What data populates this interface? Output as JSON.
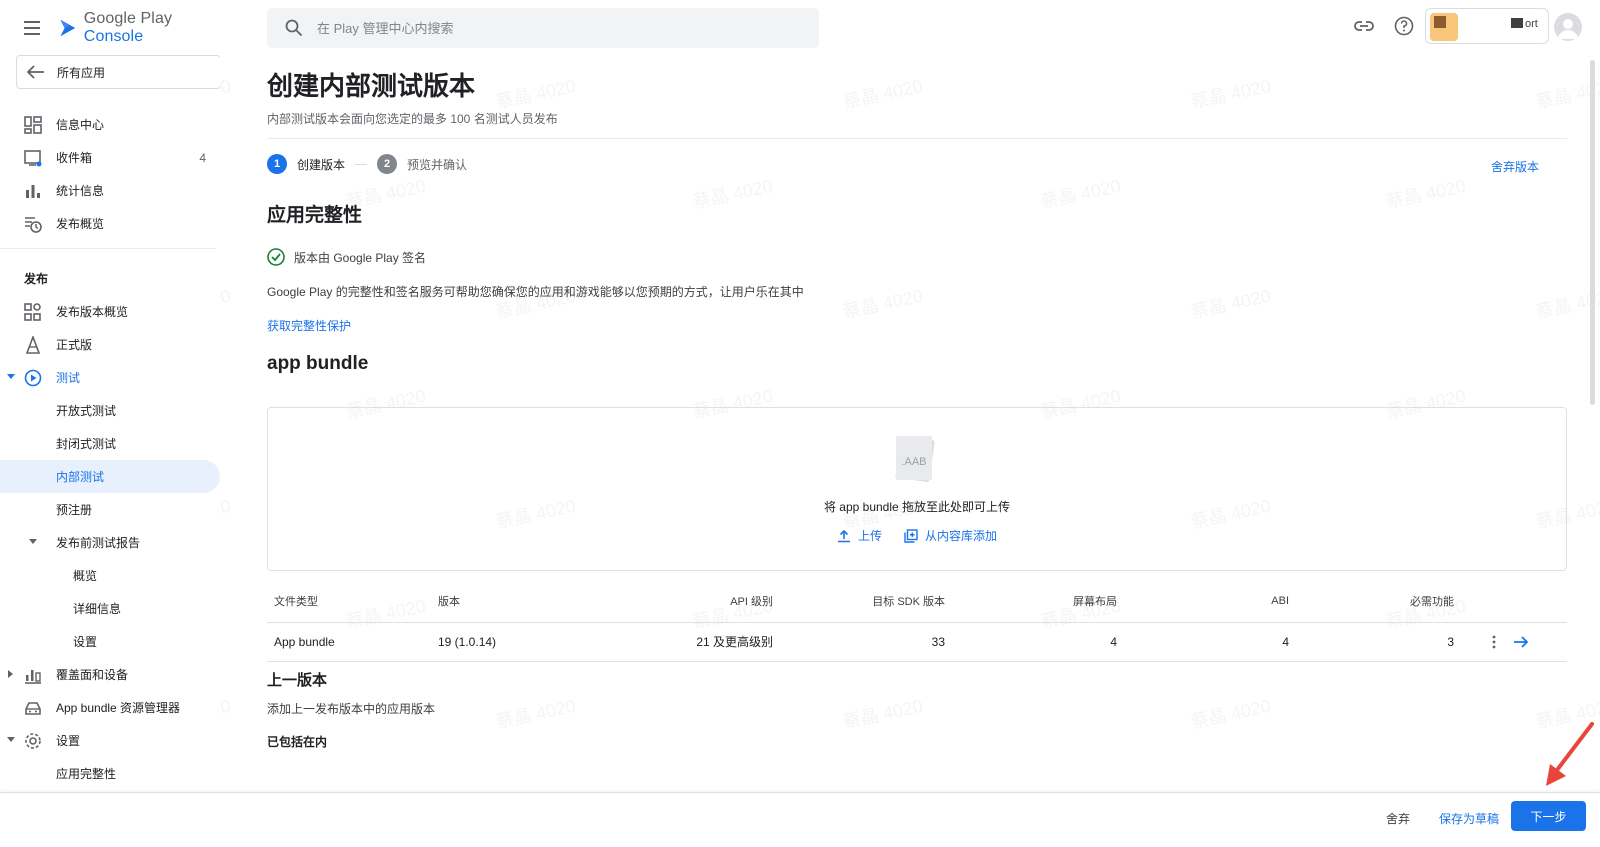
{
  "app": {
    "brand_google": "Google Play",
    "brand_console": "Console"
  },
  "search": {
    "placeholder": "在 Play 管理中心内搜索"
  },
  "account": {
    "name_fragment": "ort"
  },
  "sidebar": {
    "back_label": "所有应用",
    "top_items": [
      {
        "label": "信息中心",
        "icon": "dashboard-icon"
      },
      {
        "label": "收件箱",
        "icon": "inbox-icon",
        "count": "4"
      },
      {
        "label": "统计信息",
        "icon": "stats-icon"
      },
      {
        "label": "发布概览",
        "icon": "publishing-overview-icon"
      }
    ],
    "section_release": "发布",
    "release_items": [
      {
        "label": "发布版本概览"
      },
      {
        "label": "正式版"
      },
      {
        "label": "测试"
      },
      {
        "label": "开放式测试"
      },
      {
        "label": "封闭式测试"
      },
      {
        "label": "内部测试"
      },
      {
        "label": "预注册"
      },
      {
        "label": "发布前测试报告"
      },
      {
        "label": "概览"
      },
      {
        "label": "详细信息"
      },
      {
        "label": "设置"
      },
      {
        "label": "覆盖面和设备"
      },
      {
        "label": "App bundle 资源管理器"
      },
      {
        "label": "设置"
      },
      {
        "label": "应用完整性"
      }
    ]
  },
  "main": {
    "title": "创建内部测试版本",
    "subtitle": "内部测试版本会面向您选定的最多 100 名测试人员发布",
    "steps": [
      {
        "num": "1",
        "label": "创建版本"
      },
      {
        "num": "2",
        "label": "预览并确认"
      }
    ],
    "discard_release": "舍弃版本",
    "integrity": {
      "heading": "应用完整性",
      "signed_text": "版本由 Google Play 签名",
      "description": "Google Play 的完整性和签名服务可帮助您确保您的应用和游戏能够以您预期的方式，让用户乐在其中",
      "link": "获取完整性保护"
    },
    "bundle": {
      "heading": "app bundle",
      "file_badge": ".AAB",
      "drop_text": "将 app bundle 拖放至此处即可上传",
      "upload": "上传",
      "add_from_library": "从内容库添加"
    },
    "table": {
      "headers": [
        "文件类型",
        "版本",
        "API 级别",
        "目标 SDK 版本",
        "屏幕布局",
        "ABI",
        "必需功能"
      ],
      "rows": [
        [
          "App bundle",
          "19 (1.0.14)",
          "21 及更高级别",
          "33",
          "4",
          "4",
          "3"
        ]
      ]
    },
    "previous": {
      "heading": "上一版本",
      "subtitle": "添加上一发布版本中的应用版本",
      "included": "已包括在内"
    }
  },
  "bottom": {
    "discard": "舍弃",
    "save_draft": "保存为草稿",
    "next": "下一步"
  },
  "watermark": "蔡晶 4020",
  "colors": {
    "accent": "#1a73e8",
    "success": "#188038",
    "annotation_arrow": "#e8453c"
  }
}
